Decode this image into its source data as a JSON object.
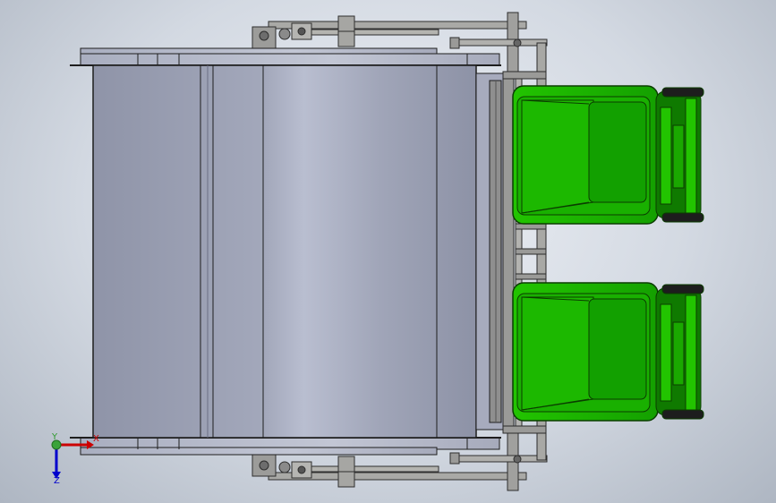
{
  "view": {
    "colors": {
      "background_center": "#eef1f6",
      "background_edge": "#aeb6c2",
      "hopper_body": "#9ea3b8",
      "hopper_highlight": "#b8bdd0",
      "frame_metal": "#8e8e92",
      "bin_green": "#19b000",
      "bin_green_dark": "#0f7a00",
      "axis_x": "#cc0000",
      "axis_y": "#2f9a2f",
      "axis_z": "#0000cc"
    },
    "bins": [
      {
        "name": "upper-bin"
      },
      {
        "name": "lower-bin"
      }
    ]
  },
  "axes": {
    "x_label": "X",
    "y_label": "Y",
    "z_label": "Z"
  }
}
